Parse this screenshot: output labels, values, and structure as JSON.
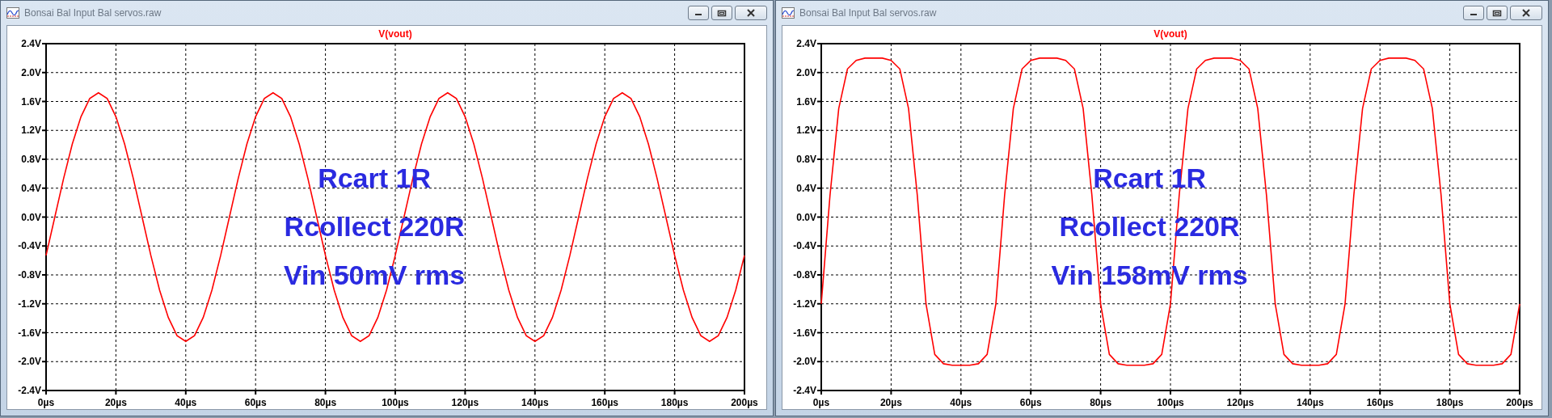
{
  "windows": [
    {
      "title": "Bonsai Bal Input Bal servos.raw",
      "chart_data": {
        "type": "line",
        "grid": true,
        "x": [
          0,
          2.5,
          5,
          7.5,
          10,
          12.5,
          15,
          17.5,
          20,
          22.5,
          25,
          27.5,
          30,
          32.5,
          35,
          37.5,
          40,
          42.5,
          45,
          47.5,
          50,
          52.5,
          55,
          57.5,
          60,
          62.5,
          65,
          67.5,
          70,
          72.5,
          75,
          77.5,
          80,
          82.5,
          85,
          87.5,
          90,
          92.5,
          95,
          97.5,
          100,
          102.5,
          105,
          107.5,
          110,
          112.5,
          115,
          117.5,
          120,
          122.5,
          125,
          127.5,
          130,
          132.5,
          135,
          137.5,
          140,
          142.5,
          145,
          147.5,
          150,
          152.5,
          155,
          157.5,
          160,
          162.5,
          165,
          167.5,
          170,
          172.5,
          175,
          177.5,
          180,
          182.5,
          185,
          187.5,
          190,
          192.5,
          195,
          197.5,
          200
        ],
        "series": [
          {
            "name": "V(vout)",
            "color": "#ff0000",
            "values": [
              -0.53,
              0,
              0.53,
              1.01,
              1.39,
              1.64,
              1.72,
              1.64,
              1.39,
              1.01,
              0.53,
              0,
              -0.53,
              -1.01,
              -1.39,
              -1.64,
              -1.72,
              -1.64,
              -1.39,
              -1.01,
              -0.53,
              0,
              0.53,
              1.01,
              1.39,
              1.64,
              1.72,
              1.64,
              1.39,
              1.01,
              0.53,
              0,
              -0.53,
              -1.01,
              -1.39,
              -1.64,
              -1.72,
              -1.64,
              -1.39,
              -1.01,
              -0.53,
              0,
              0.53,
              1.01,
              1.39,
              1.64,
              1.72,
              1.64,
              1.39,
              1.01,
              0.53,
              0,
              -0.53,
              -1.01,
              -1.39,
              -1.64,
              -1.72,
              -1.64,
              -1.39,
              -1.01,
              -0.53,
              0,
              0.53,
              1.01,
              1.39,
              1.64,
              1.72,
              1.64,
              1.39,
              1.01,
              0.53,
              0,
              -0.53,
              -1.01,
              -1.39,
              -1.64,
              -1.72,
              -1.64,
              -1.39,
              -1.01,
              -0.53
            ]
          }
        ],
        "xlim": [
          0,
          200
        ],
        "ylim": [
          -2.4,
          2.4
        ],
        "xticks": [
          {
            "value": 0,
            "label": "0µs"
          },
          {
            "value": 20,
            "label": "20µs"
          },
          {
            "value": 40,
            "label": "40µs"
          },
          {
            "value": 60,
            "label": "60µs"
          },
          {
            "value": 80,
            "label": "80µs"
          },
          {
            "value": 100,
            "label": "100µs"
          },
          {
            "value": 120,
            "label": "120µs"
          },
          {
            "value": 140,
            "label": "140µs"
          },
          {
            "value": 160,
            "label": "160µs"
          },
          {
            "value": 180,
            "label": "180µs"
          },
          {
            "value": 200,
            "label": "200µs"
          }
        ],
        "yticks": [
          {
            "value": 2.4,
            "label": "2.4V"
          },
          {
            "value": 2.0,
            "label": "2.0V"
          },
          {
            "value": 1.6,
            "label": "1.6V"
          },
          {
            "value": 1.2,
            "label": "1.2V"
          },
          {
            "value": 0.8,
            "label": "0.8V"
          },
          {
            "value": 0.4,
            "label": "0.4V"
          },
          {
            "value": 0,
            "label": "0.0V"
          },
          {
            "value": -0.4,
            "label": "-0.4V"
          },
          {
            "value": -0.8,
            "label": "-0.8V"
          },
          {
            "value": -1.2,
            "label": "-1.2V"
          },
          {
            "value": -1.6,
            "label": "-1.6V"
          },
          {
            "value": -2.0,
            "label": "-2.0V"
          },
          {
            "value": -2.4,
            "label": "-2.4V"
          }
        ],
        "annotations": [
          {
            "text": "Rcart 1R"
          },
          {
            "text": "Rcollect 220R"
          },
          {
            "text": "Vin 50mV rms"
          }
        ]
      }
    },
    {
      "title": "Bonsai Bal Input Bal servos.raw",
      "chart_data": {
        "type": "line",
        "grid": true,
        "x": [
          0,
          2.5,
          5,
          7.5,
          10,
          12.5,
          15,
          17.5,
          20,
          22.5,
          25,
          27.5,
          30,
          32.5,
          35,
          37.5,
          40,
          42.5,
          45,
          47.5,
          50,
          52.5,
          55,
          57.5,
          60,
          62.5,
          65,
          67.5,
          70,
          72.5,
          75,
          77.5,
          80,
          82.5,
          85,
          87.5,
          90,
          92.5,
          95,
          97.5,
          100,
          102.5,
          105,
          107.5,
          110,
          112.5,
          115,
          117.5,
          120,
          122.5,
          125,
          127.5,
          130,
          132.5,
          135,
          137.5,
          140,
          142.5,
          145,
          147.5,
          150,
          152.5,
          155,
          157.5,
          160,
          162.5,
          165,
          167.5,
          170,
          172.5,
          175,
          177.5,
          180,
          182.5,
          185,
          187.5,
          190,
          192.5,
          195,
          197.5,
          200
        ],
        "series": [
          {
            "name": "V(vout)",
            "color": "#ff0000",
            "values": [
              -1.2,
              0.3,
              1.5,
              2.05,
              2.17,
              2.2,
              2.2,
              2.2,
              2.17,
              2.05,
              1.5,
              0.3,
              -1.2,
              -1.9,
              -2.03,
              -2.05,
              -2.05,
              -2.05,
              -2.03,
              -1.9,
              -1.2,
              0.3,
              1.5,
              2.05,
              2.17,
              2.2,
              2.2,
              2.2,
              2.17,
              2.05,
              1.5,
              0.3,
              -1.2,
              -1.9,
              -2.03,
              -2.05,
              -2.05,
              -2.05,
              -2.03,
              -1.9,
              -1.2,
              0.3,
              1.5,
              2.05,
              2.17,
              2.2,
              2.2,
              2.2,
              2.17,
              2.05,
              1.5,
              0.3,
              -1.2,
              -1.9,
              -2.03,
              -2.05,
              -2.05,
              -2.05,
              -2.03,
              -1.9,
              -1.2,
              0.3,
              1.5,
              2.05,
              2.17,
              2.2,
              2.2,
              2.2,
              2.17,
              2.05,
              1.5,
              0.3,
              -1.2,
              -1.9,
              -2.03,
              -2.05,
              -2.05,
              -2.05,
              -2.03,
              -1.9,
              -1.2
            ]
          }
        ],
        "xlim": [
          0,
          200
        ],
        "ylim": [
          -2.4,
          2.4
        ],
        "xticks": [
          {
            "value": 0,
            "label": "0µs"
          },
          {
            "value": 20,
            "label": "20µs"
          },
          {
            "value": 40,
            "label": "40µs"
          },
          {
            "value": 60,
            "label": "60µs"
          },
          {
            "value": 80,
            "label": "80µs"
          },
          {
            "value": 100,
            "label": "100µs"
          },
          {
            "value": 120,
            "label": "120µs"
          },
          {
            "value": 140,
            "label": "140µs"
          },
          {
            "value": 160,
            "label": "160µs"
          },
          {
            "value": 180,
            "label": "180µs"
          },
          {
            "value": 200,
            "label": "200µs"
          }
        ],
        "yticks": [
          {
            "value": 2.4,
            "label": "2.4V"
          },
          {
            "value": 2.0,
            "label": "2.0V"
          },
          {
            "value": 1.6,
            "label": "1.6V"
          },
          {
            "value": 1.2,
            "label": "1.2V"
          },
          {
            "value": 0.8,
            "label": "0.8V"
          },
          {
            "value": 0.4,
            "label": "0.4V"
          },
          {
            "value": 0,
            "label": "0.0V"
          },
          {
            "value": -0.4,
            "label": "-0.4V"
          },
          {
            "value": -0.8,
            "label": "-0.8V"
          },
          {
            "value": -1.2,
            "label": "-1.2V"
          },
          {
            "value": -1.6,
            "label": "-1.6V"
          },
          {
            "value": -2.0,
            "label": "-2.0V"
          },
          {
            "value": -2.4,
            "label": "-2.4V"
          }
        ],
        "annotations": [
          {
            "text": "Rcart 1R"
          },
          {
            "text": "Rcollect 220R"
          },
          {
            "text": "Vin 158mV rms"
          }
        ]
      }
    }
  ]
}
